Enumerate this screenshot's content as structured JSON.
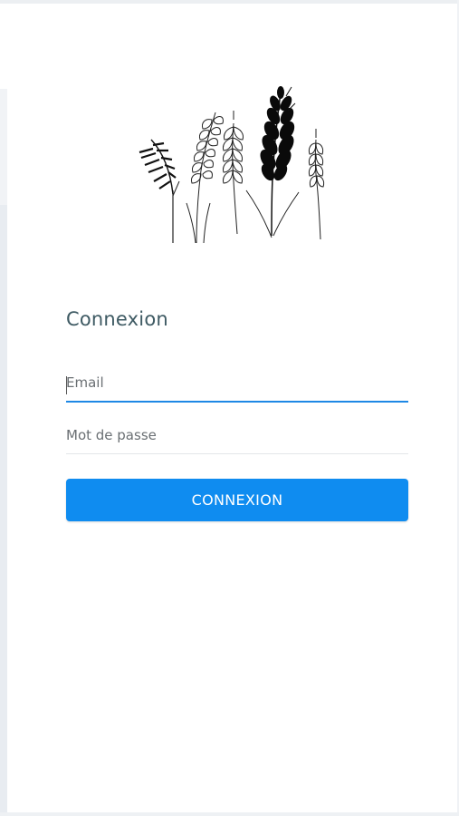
{
  "login": {
    "title": "Connexion",
    "email": {
      "placeholder": "Email",
      "value": ""
    },
    "password": {
      "placeholder": "Mot de passe",
      "value": ""
    },
    "submit_label": "CONNEXION"
  },
  "logo": {
    "icon": "wheat-stalks-icon"
  },
  "colors": {
    "title": "#3e5a63",
    "accent": "#1e88e5",
    "button": "#0f8cf0",
    "button_text": "#ffffff",
    "field_border": "#e3e6e9",
    "page_background": "#e8ecf1"
  }
}
